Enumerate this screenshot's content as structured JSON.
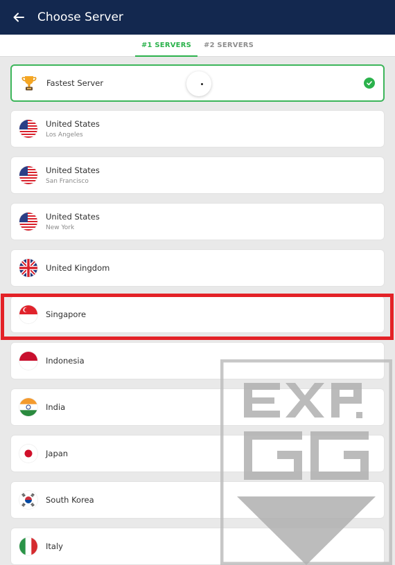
{
  "header": {
    "title": "Choose Server"
  },
  "tabs": [
    {
      "label": "#1 SERVERS",
      "active": true
    },
    {
      "label": "#2 SERVERS",
      "active": false
    }
  ],
  "servers": [
    {
      "name": "Fastest Server",
      "sub": "",
      "icon": "trophy-icon",
      "selected": true
    },
    {
      "name": "United States",
      "sub": "Los Angeles",
      "icon": "us-flag-icon"
    },
    {
      "name": "United States",
      "sub": "San Francisco",
      "icon": "us-flag-icon"
    },
    {
      "name": "United States",
      "sub": "New York",
      "icon": "us-flag-icon"
    },
    {
      "name": "United Kingdom",
      "sub": "",
      "icon": "uk-flag-icon"
    },
    {
      "name": "Singapore",
      "sub": "",
      "icon": "singapore-flag-icon"
    },
    {
      "name": "Indonesia",
      "sub": "",
      "icon": "indonesia-flag-icon"
    },
    {
      "name": "India",
      "sub": "",
      "icon": "india-flag-icon"
    },
    {
      "name": "Japan",
      "sub": "",
      "icon": "japan-flag-icon"
    },
    {
      "name": "South Korea",
      "sub": "",
      "icon": "south-korea-flag-icon"
    },
    {
      "name": "Italy",
      "sub": "",
      "icon": "italy-flag-icon"
    }
  ],
  "highlight": {
    "target": "Singapore",
    "color": "#e32227"
  },
  "watermark": {
    "icon": "exp-gg-watermark",
    "text": "EXP GG"
  },
  "colors": {
    "appbar": "#13284f",
    "accent": "#2bb24c"
  }
}
